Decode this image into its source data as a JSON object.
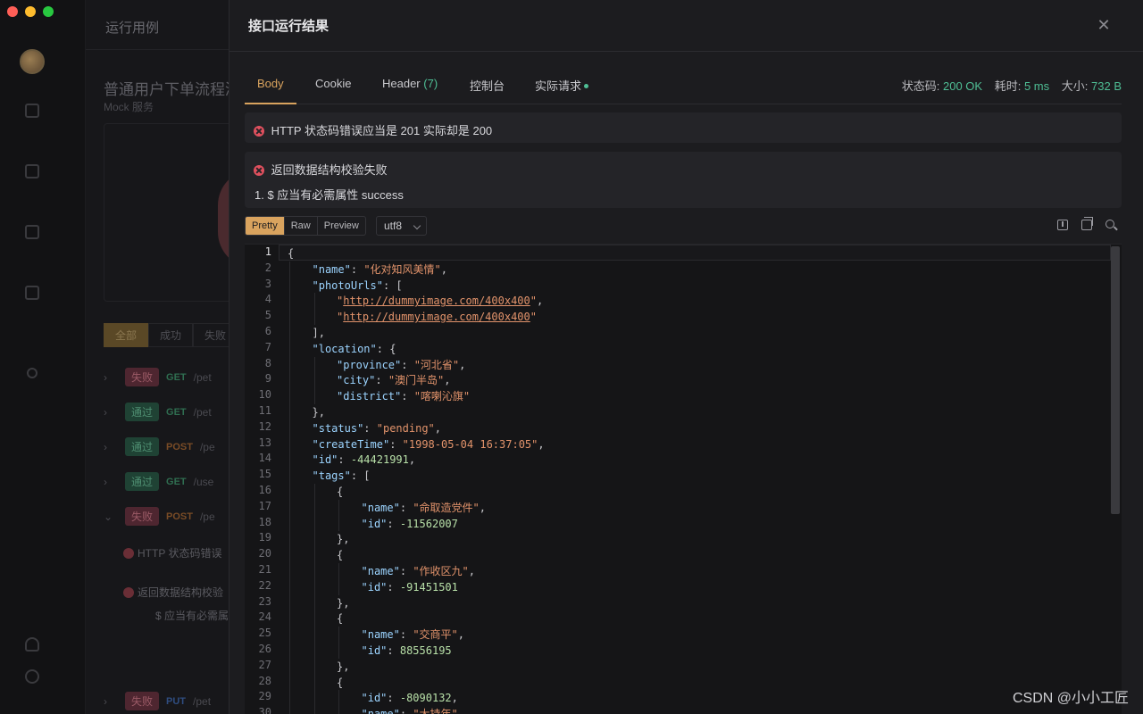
{
  "window": {
    "traffic_colors": [
      "#ff5f57",
      "#febc2e",
      "#28c840"
    ]
  },
  "background": {
    "page_title": "运行用例",
    "case_title": "普通用户下单流程测",
    "case_sub": "Mock 服务",
    "filters": [
      "全部",
      "成功",
      "失败"
    ],
    "rows": [
      {
        "status": "失败",
        "method": "GET",
        "path": "/pet"
      },
      {
        "status": "通过",
        "method": "GET",
        "path": "/pet"
      },
      {
        "status": "通过",
        "method": "POST",
        "path": "/pe"
      },
      {
        "status": "通过",
        "method": "GET",
        "path": "/use"
      },
      {
        "status": "失败",
        "method": "POST",
        "path": "/pe"
      }
    ],
    "err1": "HTTP 状态码错误",
    "err2": "返回数据结构校验",
    "err2_detail": "$ 应当有必需属",
    "last_row": {
      "status": "失败",
      "method": "PUT",
      "path": "/pet"
    }
  },
  "drawer": {
    "title": "接口运行结果",
    "close_icon": "close-icon"
  },
  "tabs": [
    {
      "label": "Body"
    },
    {
      "label": "Cookie"
    },
    {
      "label": "Header",
      "count": "(7)"
    },
    {
      "label": "控制台"
    },
    {
      "label": "实际请求"
    }
  ],
  "stats": {
    "status_label": "状态码:",
    "status_value": "200 OK",
    "time_label": "耗时:",
    "time_value": "5 ms",
    "size_label": "大小:",
    "size_value": "732 B"
  },
  "errors": {
    "status_error": "HTTP 状态码错误应当是 201 实际却是 200",
    "schema_error_title": "返回数据结构校验失败",
    "schema_error_detail": "1. $ 应当有必需属性 success"
  },
  "format": {
    "modes": [
      "Pretty",
      "Raw",
      "Preview"
    ],
    "active_mode": "Pretty",
    "encoding": "utf8",
    "icons": [
      "download-icon",
      "copy-icon",
      "search-icon"
    ]
  },
  "editor": {
    "lines": [
      {
        "n": "1",
        "indent": 0,
        "html": "{"
      },
      {
        "n": "2",
        "indent": 1,
        "html": "<span class='k'>\"name\"</span>: <span class='s'>\"化对知风美情\"</span>,"
      },
      {
        "n": "3",
        "indent": 1,
        "html": "<span class='k'>\"photoUrls\"</span>: ["
      },
      {
        "n": "4",
        "indent": 2,
        "html": "<span class='s'>\"</span><span class='u'>http://dummyimage.com/400x400</span><span class='s'>\"</span>,"
      },
      {
        "n": "5",
        "indent": 2,
        "html": "<span class='s'>\"</span><span class='u'>http://dummyimage.com/400x400</span><span class='s'>\"</span>"
      },
      {
        "n": "6",
        "indent": 1,
        "html": "],"
      },
      {
        "n": "7",
        "indent": 1,
        "html": "<span class='k'>\"location\"</span>: {"
      },
      {
        "n": "8",
        "indent": 2,
        "html": "<span class='k'>\"province\"</span>: <span class='s'>\"河北省\"</span>,"
      },
      {
        "n": "9",
        "indent": 2,
        "html": "<span class='k'>\"city\"</span>: <span class='s'>\"澳门半岛\"</span>,"
      },
      {
        "n": "10",
        "indent": 2,
        "html": "<span class='k'>\"district\"</span>: <span class='s'>\"喀喇沁旗\"</span>"
      },
      {
        "n": "11",
        "indent": 1,
        "html": "},"
      },
      {
        "n": "12",
        "indent": 1,
        "html": "<span class='k'>\"status\"</span>: <span class='s'>\"pending\"</span>,"
      },
      {
        "n": "13",
        "indent": 1,
        "html": "<span class='k'>\"createTime\"</span>: <span class='s'>\"1998-05-04 16:37:05\"</span>,"
      },
      {
        "n": "14",
        "indent": 1,
        "html": "<span class='k'>\"id\"</span>: <span class='n'>-44421991</span>,"
      },
      {
        "n": "15",
        "indent": 1,
        "html": "<span class='k'>\"tags\"</span>: ["
      },
      {
        "n": "16",
        "indent": 2,
        "html": "{"
      },
      {
        "n": "17",
        "indent": 3,
        "html": "<span class='k'>\"name\"</span>: <span class='s'>\"命取造党件\"</span>,"
      },
      {
        "n": "18",
        "indent": 3,
        "html": "<span class='k'>\"id\"</span>: <span class='n'>-11562007</span>"
      },
      {
        "n": "19",
        "indent": 2,
        "html": "},"
      },
      {
        "n": "20",
        "indent": 2,
        "html": "{"
      },
      {
        "n": "21",
        "indent": 3,
        "html": "<span class='k'>\"name\"</span>: <span class='s'>\"作收区九\"</span>,"
      },
      {
        "n": "22",
        "indent": 3,
        "html": "<span class='k'>\"id\"</span>: <span class='n'>-91451501</span>"
      },
      {
        "n": "23",
        "indent": 2,
        "html": "},"
      },
      {
        "n": "24",
        "indent": 2,
        "html": "{"
      },
      {
        "n": "25",
        "indent": 3,
        "html": "<span class='k'>\"name\"</span>: <span class='s'>\"交商平\"</span>,"
      },
      {
        "n": "26",
        "indent": 3,
        "html": "<span class='k'>\"id\"</span>: <span class='n'>88556195</span>"
      },
      {
        "n": "27",
        "indent": 2,
        "html": "},"
      },
      {
        "n": "28",
        "indent": 2,
        "html": "{"
      },
      {
        "n": "29",
        "indent": 3,
        "html": "<span class='k'>\"id\"</span>: <span class='n'>-8090132</span>,"
      },
      {
        "n": "30",
        "indent": 3,
        "html": "<span class='k'>\"name\"</span>: <span class='s'>\"大持年\"</span>"
      }
    ]
  },
  "watermark": "CSDN @小小工匠"
}
